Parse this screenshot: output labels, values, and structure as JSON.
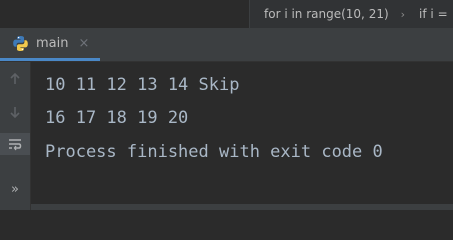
{
  "breadcrumb": {
    "items": [
      "for i in range(10, 21)",
      "if i ="
    ]
  },
  "tab": {
    "label": "main",
    "close_glyph": "×",
    "icon": "python-icon"
  },
  "sidebar": {
    "icons": [
      "arrow-up-icon",
      "arrow-down-icon",
      "soft-wrap-icon",
      "expand-chevrons-icon"
    ],
    "expand_glyph": "»"
  },
  "console": {
    "lines": [
      "10 11 12 13 14 Skip",
      "16 17 18 19 20",
      "Process finished with exit code 0"
    ]
  },
  "colors": {
    "background": "#2b2b2b",
    "tab_underline": "#4a88c7",
    "console_text": "#a9b7c6"
  }
}
